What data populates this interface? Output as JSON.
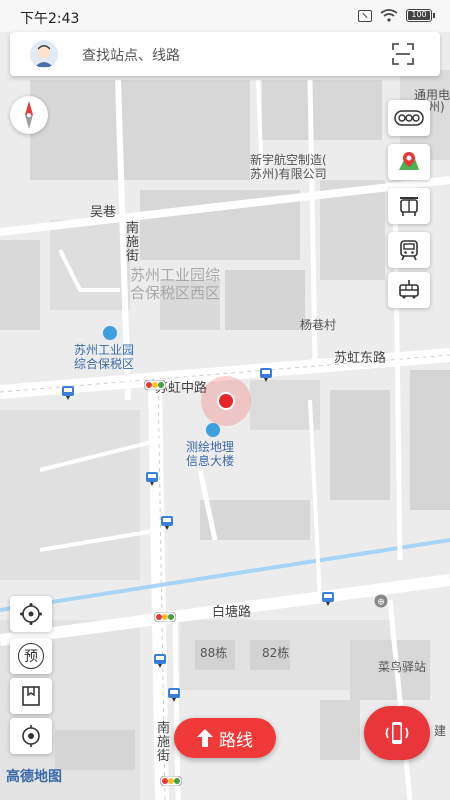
{
  "status_bar": {
    "time": "下午2:43",
    "battery_label": "100"
  },
  "search": {
    "placeholder": "查找站点、线路",
    "avatar_icon": "user-avatar-icon",
    "scan_icon": "scan-icon"
  },
  "map": {
    "labels": {
      "park_zone": "苏州工业园综",
      "park_zone_2": "合保税区西区",
      "park_office": "苏州工业园",
      "park_office_2": "综合保税区",
      "aero_company": "新宇航空制造(",
      "aero_company_2": "苏州)有限公司",
      "tonyong": "通用电",
      "tonyong_2": "州)",
      "wu_lane": "吴巷",
      "nanshi_street": "南",
      "nanshi_street_2": "施",
      "nanshi_street_3": "街",
      "yangxiang_village": "杨巷村",
      "suhong_east": "苏虹东路",
      "suhong_middle": "苏虹中路",
      "survey_building": "测绘地理",
      "survey_building_2": "信息大楼",
      "baitang_road": "白塘路",
      "bldg_88": "88栋",
      "bldg_82": "82栋",
      "cainiao": "菜鸟驿站",
      "nanshi_lower": "南",
      "nanshi_lower_2": "施",
      "nanshi_lower_3": "街",
      "edge_text": "建"
    }
  },
  "right_tools": [
    {
      "name": "traffic-light-icon"
    },
    {
      "name": "nearby-station-icon"
    },
    {
      "name": "bus-stop-icon"
    },
    {
      "name": "metro-icon"
    },
    {
      "name": "bus-route-icon"
    }
  ],
  "left_tools": [
    {
      "name": "layers-icon"
    },
    {
      "name": "reserve-icon",
      "label": "预"
    },
    {
      "name": "bookmark-icon"
    },
    {
      "name": "locate-icon"
    }
  ],
  "route_button": {
    "label": "路线"
  },
  "logo": {
    "text": "高德地图"
  },
  "colors": {
    "accent_red": "#e8363a",
    "poi_blue": "#3fa0e0",
    "logo_blue": "#3b6aa8",
    "road_white": "#ffffff",
    "block_gray": "#d9d9d9",
    "water_blue": "#a8d4f5"
  }
}
